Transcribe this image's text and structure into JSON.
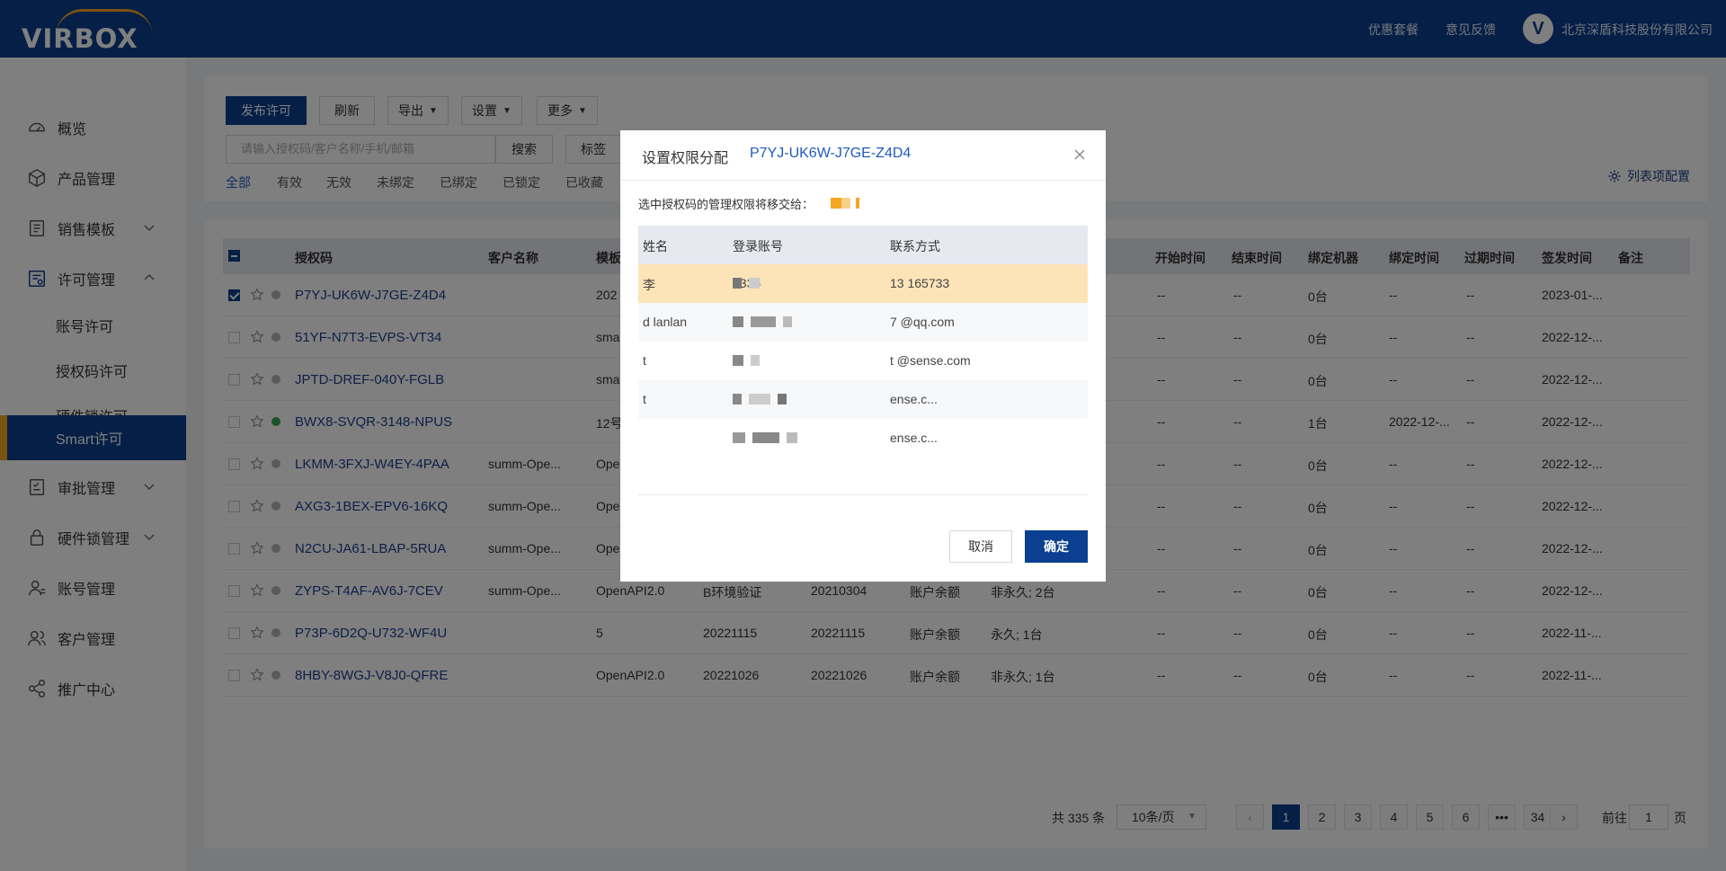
{
  "header": {
    "logo_text": "VIRBOX",
    "links": [
      "优惠套餐",
      "意见反馈"
    ],
    "company": "北京深盾科技股份有限公司"
  },
  "sidebar": {
    "items": [
      {
        "label": "概览",
        "icon": "dashboard-icon"
      },
      {
        "label": "产品管理",
        "icon": "product-box-icon"
      },
      {
        "label": "销售模板",
        "icon": "template-icon",
        "expandable": true
      },
      {
        "label": "许可管理",
        "icon": "license-icon",
        "expanded": true
      },
      {
        "label": "审批管理",
        "icon": "approval-icon",
        "expandable": true
      },
      {
        "label": "硬件锁管理",
        "icon": "lock-icon",
        "expandable": true
      },
      {
        "label": "账号管理",
        "icon": "user-icon"
      },
      {
        "label": "客户管理",
        "icon": "customers-icon"
      },
      {
        "label": "推广中心",
        "icon": "share-icon"
      }
    ],
    "sub_items": [
      "账号许可",
      "授权码许可",
      "硬件锁许可",
      "Smart许可"
    ],
    "active_sub": "Smart许可"
  },
  "toolbar": {
    "publish": "发布许可",
    "refresh": "刷新",
    "export": "导出",
    "settings": "设置",
    "more": "更多",
    "search_placeholder": "请输入授权码/客户名称/手机/邮箱",
    "search": "搜索",
    "tag": "标签",
    "column_config": "列表项配置"
  },
  "filters": [
    "全部",
    "有效",
    "无效",
    "未绑定",
    "已绑定",
    "已锁定",
    "已收藏"
  ],
  "active_filter": "全部",
  "table": {
    "headers": {
      "code": "授权码",
      "customer": "客户名称",
      "template": "模板",
      "start": "开始时间",
      "end": "结束时间",
      "machines": "绑定机器",
      "bind_time": "绑定时间",
      "expire": "过期时间",
      "issued": "签发时间",
      "note": "备注"
    },
    "rows": [
      {
        "checked": true,
        "online": false,
        "code": "P7YJ-UK6W-J7GE-Z4D4",
        "customer": "",
        "template": "202",
        "c4": "",
        "c5": "",
        "c6": "",
        "c7": "",
        "start": "--",
        "end": "--",
        "machines": "0台",
        "bind_time": "--",
        "expire": "--",
        "issued": "2023-01-..."
      },
      {
        "checked": false,
        "online": false,
        "code": "51YF-N7T3-EVPS-VT34",
        "customer": "",
        "template": "sma",
        "c4": "",
        "c5": "",
        "c6": "",
        "c7": "",
        "start": "--",
        "end": "--",
        "machines": "0台",
        "bind_time": "--",
        "expire": "--",
        "issued": "2022-12-..."
      },
      {
        "checked": false,
        "online": false,
        "code": "JPTD-DREF-040Y-FGLB",
        "customer": "",
        "template": "sma",
        "c4": "",
        "c5": "",
        "c6": "",
        "c7": "",
        "start": "--",
        "end": "--",
        "machines": "0台",
        "bind_time": "--",
        "expire": "--",
        "issued": "2022-12-..."
      },
      {
        "checked": false,
        "online": true,
        "code": "BWX8-SVQR-3148-NPUS",
        "customer": "",
        "template": "12号",
        "c4": "",
        "c5": "",
        "c6": "",
        "c7": "",
        "start": "--",
        "end": "--",
        "machines": "1台",
        "bind_time": "2022-12-...",
        "expire": "--",
        "issued": "2022-12-..."
      },
      {
        "checked": false,
        "online": false,
        "code": "LKMM-3FXJ-W4EY-4PAA",
        "customer": "summ-Ope...",
        "template": "Ope",
        "c4": "",
        "c5": "",
        "c6": "",
        "c7": "",
        "start": "--",
        "end": "--",
        "machines": "0台",
        "bind_time": "--",
        "expire": "--",
        "issued": "2022-12-..."
      },
      {
        "checked": false,
        "online": false,
        "code": "AXG3-1BEX-EPV6-16KQ",
        "customer": "summ-Ope...",
        "template": "Ope",
        "c4": "",
        "c5": "",
        "c6": "",
        "c7": "",
        "start": "--",
        "end": "--",
        "machines": "0台",
        "bind_time": "--",
        "expire": "--",
        "issued": "2022-12-..."
      },
      {
        "checked": false,
        "online": false,
        "code": "N2CU-JA61-LBAP-5RUA",
        "customer": "summ-Ope...",
        "template": "Ope",
        "c4": "",
        "c5": "",
        "c6": "",
        "c7": "",
        "start": "--",
        "end": "--",
        "machines": "0台",
        "bind_time": "--",
        "expire": "--",
        "issued": "2022-12-..."
      },
      {
        "checked": false,
        "online": false,
        "code": "ZYPS-T4AF-AV6J-7CEV",
        "customer": "summ-Ope...",
        "template": "OpenAPI2.0",
        "c4": "B环境验证",
        "c5": "20210304",
        "c6": "账户余额",
        "c7": "非永久; 2台",
        "start": "--",
        "end": "--",
        "machines": "0台",
        "bind_time": "--",
        "expire": "--",
        "issued": "2022-12-..."
      },
      {
        "checked": false,
        "online": false,
        "code": "P73P-6D2Q-U732-WF4U",
        "customer": "",
        "template": "5",
        "c4": "20221115",
        "c5": "20221115",
        "c6": "账户余额",
        "c7": "永久; 1台",
        "start": "--",
        "end": "--",
        "machines": "0台",
        "bind_time": "--",
        "expire": "--",
        "issued": "2022-11-..."
      },
      {
        "checked": false,
        "online": false,
        "code": "8HBY-8WGJ-V8J0-QFRE",
        "customer": "",
        "template": "OpenAPI2.0",
        "c4": "20221026",
        "c5": "20221026",
        "c6": "账户余额",
        "c7": "非永久; 1台",
        "start": "--",
        "end": "--",
        "machines": "0台",
        "bind_time": "--",
        "expire": "--",
        "issued": "2022-11-..."
      }
    ]
  },
  "pagination": {
    "total": "共 335 条",
    "page_size": "10条/页",
    "pages": [
      "1",
      "2",
      "3",
      "4",
      "5",
      "6",
      "•••",
      "34"
    ],
    "current": "1",
    "goto_label": "前往",
    "goto_value": "1",
    "goto_suffix": "页",
    "prev": "‹",
    "next": "›"
  },
  "modal": {
    "title": "设置权限分配",
    "code": "P7YJ-UK6W-J7GE-Z4D4",
    "hint": "选中授权码的管理权限将移交给：",
    "headers": {
      "name": "姓名",
      "account": "登录账号",
      "contact": "联系方式"
    },
    "rows": [
      {
        "name": "李",
        "account": "1336",
        "contact": "13    165733",
        "selected": true
      },
      {
        "name": "d    lanlan",
        "account": "",
        "contact": "7    @qq.com",
        "selected": false
      },
      {
        "name": "t",
        "account": "",
        "contact": "t    @sense.com",
        "selected": false
      },
      {
        "name": "t",
        "account": "",
        "contact": "ense.c...",
        "selected": false
      },
      {
        "name": "",
        "account": "",
        "contact": "ense.c...",
        "selected": false
      }
    ],
    "cancel": "取消",
    "confirm": "确定"
  }
}
